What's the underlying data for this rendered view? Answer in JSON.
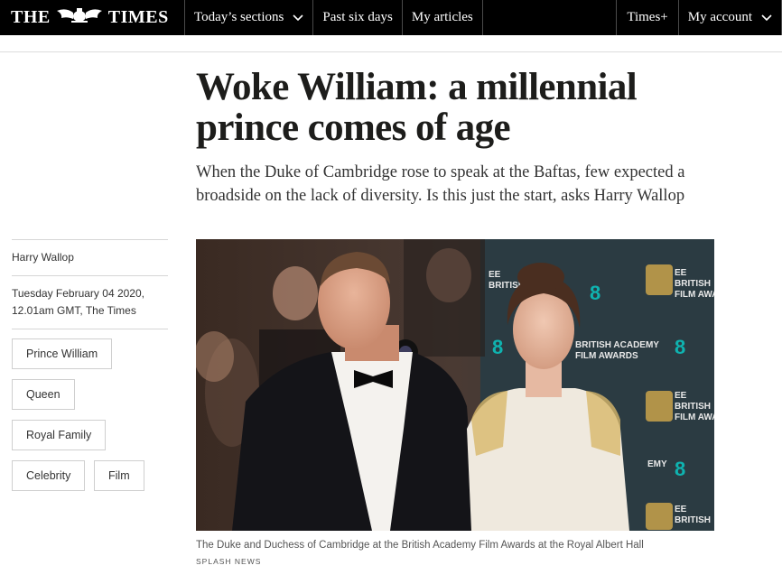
{
  "nav": {
    "logo_left": "THE",
    "logo_right": "TIMES",
    "items": [
      {
        "label": "Today’s sections",
        "has_dropdown": true
      },
      {
        "label": "Past six days",
        "has_dropdown": false
      },
      {
        "label": "My articles",
        "has_dropdown": false
      }
    ],
    "times_plus": "Times+",
    "account": "My account"
  },
  "article": {
    "headline": "Woke William: a millennial prince comes of age",
    "standfirst": "When the Duke of Cambridge rose to speak at the Baftas, few expected a broadside on the lack of diversity. Is this just the start, asks Harry Wallop",
    "author": "Harry Wallop",
    "dateline": "Tuesday February 04 2020, 12.01am GMT, The Times",
    "tags": [
      "Prince William",
      "Queen",
      "Royal Family",
      "Celebrity",
      "Film"
    ],
    "image": {
      "description_icon": "photo",
      "caption": "The Duke and Duchess of Cambridge at the British Academy Film Awards at the Royal Albert Hall",
      "credit": "SPLASH NEWS",
      "backdrop_text": [
        "EE",
        "BRITISH",
        "FILM AWARDS",
        "BRITISH ACADEMY",
        "FILM AWARDS",
        "EMY"
      ]
    }
  },
  "colors": {
    "nav_bg": "#000000",
    "headline": "#1d1d1b",
    "backdrop": "#2a3a40",
    "gold": "#c9a34a"
  }
}
